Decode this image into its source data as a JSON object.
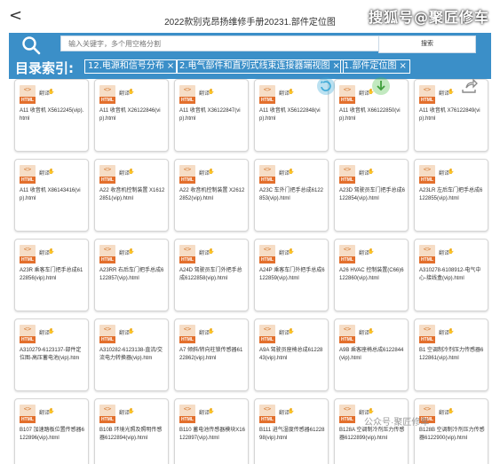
{
  "app": {
    "back_glyph": "<",
    "title": "2022款别克昂扬维修手册20231.部件定位图",
    "watermark": "搜狐号@聚匠修车"
  },
  "search": {
    "placeholder": "输入关键字，多个用空格分割",
    "button_label": "搜索"
  },
  "index": {
    "label": "目录索引:",
    "chips": [
      {
        "text": "12.电源和信号分布",
        "close": "×"
      },
      {
        "text": "2.电气部件和直列式线束连接器端视图",
        "close": "×"
      },
      {
        "text": "1.部件定位图",
        "close": "×"
      }
    ]
  },
  "card_common": {
    "icon_code": "<>",
    "icon_badge": "HTML",
    "translate_label": "翻译"
  },
  "cards": [
    {
      "name": "A11 收音机 X5612245(vip).html"
    },
    {
      "name": "A11 收音机 X26122846(vip).html"
    },
    {
      "name": "A11 收音机 X36122847(vip).html"
    },
    {
      "name": "A11 收音机 X56122848(vip).html"
    },
    {
      "name": "A11 收音机 X66122850(vip).html"
    },
    {
      "name": "A11 收音机 X76122849(vip).html"
    },
    {
      "name": "A11 收音机 X86143416(vip).html"
    },
    {
      "name": "A22 收音机控制装置 X16122851(vip).html"
    },
    {
      "name": "A22 收音机控制装置 X26122852(vip).html"
    },
    {
      "name": "A23C 车外门把手总成6122853(vip).html"
    },
    {
      "name": "A23D 驾驶员车门把手总成6122854(vip).html"
    },
    {
      "name": "A23LR 左后车门把手总成6122855(vip).html"
    },
    {
      "name": "A23R 乘客车门把手总成6122856(vip).html"
    },
    {
      "name": "A23RR 右后车门把手总成6122857(vip).html"
    },
    {
      "name": "A24D 驾驶员车门外把手总成6122858(vip).html"
    },
    {
      "name": "A24P 乘客车门外把手总成6122859(vip).html"
    },
    {
      "name": "A26 HVAC 控制装置(C66)6122860(vip).html"
    },
    {
      "name": "A310278-6108912-电气中心-接线盒(vip).html"
    },
    {
      "name": "A310279-6123137-部件定位图-高压蓄电池(vip).htm"
    },
    {
      "name": "A310282-6123138-直流/交流电力转换器(vip).htm"
    },
    {
      "name": "A7 倾斜/转向柱锁传感器6122862(vip).html"
    },
    {
      "name": "A9A 驾驶员座椅总成6122843(vip).html"
    },
    {
      "name": "A9B 乘客座椅总成6122844(vip).html"
    },
    {
      "name": "B1 空调制冷剂压力传感器6122861(vip).html"
    },
    {
      "name": "B107 加速踏板位置传感器6122896(vip).html"
    },
    {
      "name": "B10B 环境光照及照明传感器6122894(vip).html"
    },
    {
      "name": "B110 蓄电池传感器模块X16122897(vip).html"
    },
    {
      "name": "B111 进气湿度传感器6122898(vip).html"
    },
    {
      "name": "B128A 空调制冷剂压力传感器6122899(vip).html"
    },
    {
      "name": "B128B 空调制冷剂压力传感器6122900(vip).html"
    }
  ],
  "bottom_watermark": "公众号·聚匠修车",
  "icons": [
    "search-icon",
    "back-icon",
    "html-file-icon",
    "close-icon",
    "refresh-icon",
    "download-icon",
    "share-icon"
  ],
  "colors": {
    "panel_blue": "#3b8fc8",
    "badge_orange": "#e36f2c",
    "green_fab": "#4fbf4a",
    "blue_fab": "#3da9d6"
  }
}
